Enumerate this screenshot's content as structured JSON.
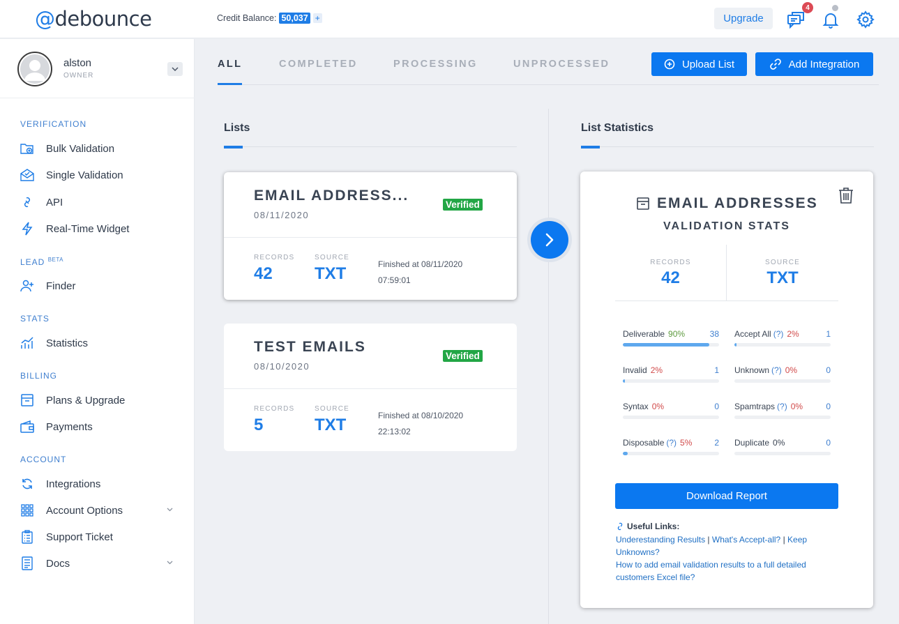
{
  "brand": {
    "logo_at": "@",
    "logo_text": "debounce"
  },
  "topbar": {
    "credit_label": "Credit Balance:",
    "credit_value": "50,037",
    "credit_plus": "+",
    "upgrade_label": "Upgrade",
    "messages_badge": "4"
  },
  "user": {
    "name": "alston",
    "role": "OWNER"
  },
  "sidebar": {
    "verification_title": "VERIFICATION",
    "bulk_validation": "Bulk Validation",
    "single_validation": "Single Validation",
    "api": "API",
    "realtime_widget": "Real-Time Widget",
    "lead_title": "LEAD",
    "lead_badge": "BETA",
    "finder": "Finder",
    "stats_title": "STATS",
    "statistics": "Statistics",
    "billing_title": "BILLING",
    "plans_upgrade": "Plans & Upgrade",
    "payments": "Payments",
    "account_title": "ACCOUNT",
    "integrations": "Integrations",
    "account_options": "Account Options",
    "support_ticket": "Support Ticket",
    "docs": "Docs"
  },
  "tabs": {
    "all": "ALL",
    "completed": "COMPLETED",
    "processing": "PROCESSING",
    "unprocessed": "UNPROCESSED"
  },
  "actions": {
    "upload_list": "Upload List",
    "add_integration": "Add Integration"
  },
  "lists": {
    "title": "Lists",
    "items": [
      {
        "name": "EMAIL ADDRESS...",
        "date": "08/11/2020",
        "status": "Verified",
        "records_label": "RECORDS",
        "records": "42",
        "source_label": "SOURCE",
        "source": "TXT",
        "finished": "Finished at 08/11/2020",
        "time": "07:59:01"
      },
      {
        "name": "TEST EMAILS",
        "date": "08/10/2020",
        "status": "Verified",
        "records_label": "RECORDS",
        "records": "5",
        "source_label": "SOURCE",
        "source": "TXT",
        "finished": "Finished at 08/10/2020",
        "time": "22:13:02"
      }
    ]
  },
  "stats": {
    "section_title": "List Statistics",
    "title": "EMAIL ADDRESSES",
    "subtitle": "VALIDATION STATS",
    "records_label": "RECORDS",
    "records": "42",
    "source_label": "SOURCE",
    "source": "TXT",
    "items": [
      {
        "label": "Deliverable",
        "q": "",
        "pct": "90%",
        "count": "38",
        "fill": 0.9,
        "tone": "green"
      },
      {
        "label": "Accept All",
        "q": "(?)",
        "pct": "2%",
        "count": "1",
        "fill": 0.02,
        "tone": "red"
      },
      {
        "label": "Invalid",
        "q": "",
        "pct": "2%",
        "count": "1",
        "fill": 0.02,
        "tone": "red"
      },
      {
        "label": "Unknown",
        "q": "(?)",
        "pct": "0%",
        "count": "0",
        "fill": 0,
        "tone": "red"
      },
      {
        "label": "Syntax",
        "q": "",
        "pct": "0%",
        "count": "0",
        "fill": 0,
        "tone": "red"
      },
      {
        "label": "Spamtraps",
        "q": "(?)",
        "pct": "0%",
        "count": "0",
        "fill": 0,
        "tone": "red"
      },
      {
        "label": "Disposable",
        "q": "(?)",
        "pct": "5%",
        "count": "2",
        "fill": 0.05,
        "tone": "red"
      },
      {
        "label": "Duplicate",
        "q": "",
        "pct": "0%",
        "count": "0",
        "fill": 0,
        "tone": "plain"
      }
    ],
    "download_label": "Download Report",
    "useful_title": "Useful Links:",
    "link1": "Underestanding Results",
    "link2": "What's Accept-all?",
    "link3": "Keep Unknowns?",
    "link4": "How to add email validation results to a full detailed customers Excel file?",
    "link_sep": "|"
  },
  "colors": {
    "accent": "#1f7de6",
    "button": "#0b78f0",
    "verified": "#22a645",
    "badge": "#dc4a55"
  }
}
